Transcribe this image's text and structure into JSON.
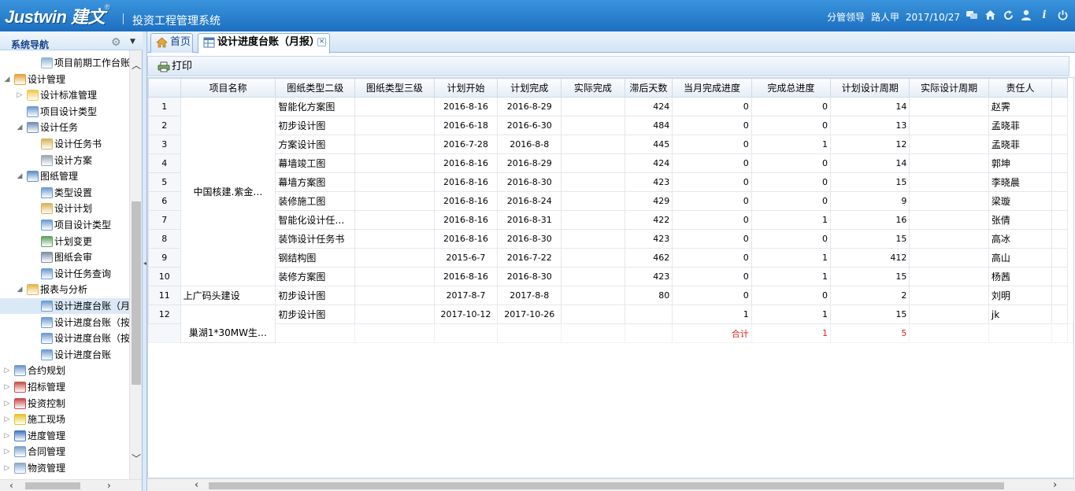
{
  "header": {
    "logo_text": "Justwin 建文",
    "logo_mark": "®",
    "system_title": "投资工程管理系统",
    "user_role": "分管领导",
    "user_name": "路人甲",
    "date": "2017/10/27"
  },
  "sidebar": {
    "title": "系统导航",
    "items": [
      {
        "label": "项目前期工作台账",
        "level": 2,
        "icon": "report-icon",
        "expand": "",
        "selected": false
      },
      {
        "label": "设计管理",
        "level": 0,
        "icon": "design-icon",
        "expand": "open",
        "selected": false
      },
      {
        "label": "设计标准管理",
        "level": 1,
        "icon": "folder-icon",
        "expand": "closed",
        "selected": false
      },
      {
        "label": "项目设计类型",
        "level": 1,
        "icon": "table-icon",
        "expand": "",
        "selected": false
      },
      {
        "label": "设计任务",
        "level": 1,
        "icon": "task-icon",
        "expand": "open",
        "selected": false
      },
      {
        "label": "设计任务书",
        "level": 2,
        "icon": "edit-icon",
        "expand": "",
        "selected": false
      },
      {
        "label": "设计方案",
        "level": 2,
        "icon": "compass-icon",
        "expand": "",
        "selected": false
      },
      {
        "label": "图纸管理",
        "level": 1,
        "icon": "drawing-icon",
        "expand": "open",
        "selected": false
      },
      {
        "label": "类型设置",
        "level": 2,
        "icon": "table-icon",
        "expand": "",
        "selected": false
      },
      {
        "label": "设计计划",
        "level": 2,
        "icon": "edit-icon",
        "expand": "",
        "selected": false
      },
      {
        "label": "项目设计类型",
        "level": 2,
        "icon": "table-icon",
        "expand": "",
        "selected": false
      },
      {
        "label": "计划变更",
        "level": 2,
        "icon": "change-icon",
        "expand": "",
        "selected": false
      },
      {
        "label": "图纸会审",
        "level": 2,
        "icon": "review-icon",
        "expand": "",
        "selected": false
      },
      {
        "label": "设计任务查询",
        "level": 2,
        "icon": "table-icon",
        "expand": "",
        "selected": false
      },
      {
        "label": "报表与分析",
        "level": 1,
        "icon": "report-folder-icon",
        "expand": "open",
        "selected": false
      },
      {
        "label": "设计进度台账（月",
        "level": 2,
        "icon": "table-icon",
        "expand": "",
        "selected": true
      },
      {
        "label": "设计进度台账（按",
        "level": 2,
        "icon": "table-icon",
        "expand": "",
        "selected": false
      },
      {
        "label": "设计进度台账（按",
        "level": 2,
        "icon": "table-icon",
        "expand": "",
        "selected": false
      },
      {
        "label": "设计进度台账",
        "level": 2,
        "icon": "table-icon",
        "expand": "",
        "selected": false
      },
      {
        "label": "合约规划",
        "level": 0,
        "icon": "contract-plan-icon",
        "expand": "closed",
        "selected": false
      },
      {
        "label": "招标管理",
        "level": 0,
        "icon": "bid-icon",
        "expand": "closed",
        "selected": false
      },
      {
        "label": "投资控制",
        "level": 0,
        "icon": "invest-icon",
        "expand": "closed",
        "selected": false
      },
      {
        "label": "施工现场",
        "level": 0,
        "icon": "site-icon",
        "expand": "closed",
        "selected": false
      },
      {
        "label": "进度管理",
        "level": 0,
        "icon": "progress-icon",
        "expand": "closed",
        "selected": false
      },
      {
        "label": "合同管理",
        "level": 0,
        "icon": "contract-icon",
        "expand": "closed",
        "selected": false
      },
      {
        "label": "物资管理",
        "level": 0,
        "icon": "material-icon",
        "expand": "closed",
        "selected": false
      }
    ]
  },
  "tabs": [
    {
      "label": "首页"
    },
    {
      "label": "设计进度台账（月报）"
    }
  ],
  "toolbar": {
    "print_label": "打印"
  },
  "table": {
    "columns": [
      "",
      "项目名称",
      "图纸类型二级",
      "图纸类型三级",
      "计划开始",
      "计划完成",
      "实际完成",
      "滞后天数",
      "当月完成进度",
      "完成总进度",
      "计划设计周期",
      "实际设计周期",
      "责任人",
      ""
    ],
    "projects": [
      "中国核建.紫金…",
      "上广码头建设",
      "巢湖1*30MW生…"
    ],
    "rows": [
      {
        "no": "1",
        "type2": "智能化方案图",
        "type3": "",
        "start": "2016-8-16",
        "end": "2016-8-29",
        "actual": "",
        "lag": "424",
        "month": "0",
        "total": "0",
        "plan_cycle": "14",
        "actual_cycle": "",
        "owner": "赵霁"
      },
      {
        "no": "2",
        "type2": "初步设计图",
        "type3": "",
        "start": "2016-6-18",
        "end": "2016-6-30",
        "actual": "",
        "lag": "484",
        "month": "0",
        "total": "0",
        "plan_cycle": "13",
        "actual_cycle": "",
        "owner": "孟晓菲"
      },
      {
        "no": "3",
        "type2": "方案设计图",
        "type3": "",
        "start": "2016-7-28",
        "end": "2016-8-8",
        "actual": "",
        "lag": "445",
        "month": "0",
        "total": "1",
        "plan_cycle": "12",
        "actual_cycle": "",
        "owner": "孟晓菲"
      },
      {
        "no": "4",
        "type2": "幕墙竣工图",
        "type3": "",
        "start": "2016-8-16",
        "end": "2016-8-29",
        "actual": "",
        "lag": "424",
        "month": "0",
        "total": "0",
        "plan_cycle": "14",
        "actual_cycle": "",
        "owner": "郭坤"
      },
      {
        "no": "5",
        "type2": "幕墙方案图",
        "type3": "",
        "start": "2016-8-16",
        "end": "2016-8-30",
        "actual": "",
        "lag": "423",
        "month": "0",
        "total": "0",
        "plan_cycle": "15",
        "actual_cycle": "",
        "owner": "李晓晨"
      },
      {
        "no": "6",
        "type2": "装修施工图",
        "type3": "",
        "start": "2016-8-16",
        "end": "2016-8-24",
        "actual": "",
        "lag": "429",
        "month": "0",
        "total": "0",
        "plan_cycle": "9",
        "actual_cycle": "",
        "owner": "梁璇"
      },
      {
        "no": "7",
        "type2": "智能化设计任…",
        "type3": "",
        "start": "2016-8-16",
        "end": "2016-8-31",
        "actual": "",
        "lag": "422",
        "month": "0",
        "total": "1",
        "plan_cycle": "16",
        "actual_cycle": "",
        "owner": "张倩"
      },
      {
        "no": "8",
        "type2": "装饰设计任务书",
        "type3": "",
        "start": "2016-8-16",
        "end": "2016-8-30",
        "actual": "",
        "lag": "423",
        "month": "0",
        "total": "0",
        "plan_cycle": "15",
        "actual_cycle": "",
        "owner": "高冰"
      },
      {
        "no": "9",
        "type2": "钢结构图",
        "type3": "",
        "start": "2015-6-7",
        "end": "2016-7-22",
        "actual": "",
        "lag": "462",
        "month": "0",
        "total": "1",
        "plan_cycle": "412",
        "actual_cycle": "",
        "owner": "高山"
      },
      {
        "no": "10",
        "type2": "装修方案图",
        "type3": "",
        "start": "2016-8-16",
        "end": "2016-8-30",
        "actual": "",
        "lag": "423",
        "month": "0",
        "total": "1",
        "plan_cycle": "15",
        "actual_cycle": "",
        "owner": "杨茜"
      },
      {
        "no": "11",
        "type2": "初步设计图",
        "type3": "",
        "start": "2017-8-7",
        "end": "2017-8-8",
        "actual": "",
        "lag": "80",
        "month": "0",
        "total": "0",
        "plan_cycle": "2",
        "actual_cycle": "",
        "owner": "刘明"
      },
      {
        "no": "12",
        "type2": "初步设计图",
        "type3": "",
        "start": "2017-10-12",
        "end": "2017-10-26",
        "actual": "",
        "lag": "",
        "month": "1",
        "total": "1",
        "plan_cycle": "15",
        "actual_cycle": "",
        "owner": "jk"
      }
    ],
    "total_label": "合计",
    "total_month": "1",
    "total_overall": "5"
  },
  "colors": {
    "header": "#2a84d2",
    "accent_text": "#15428b",
    "total_red": "#e0201c",
    "selected_row": "#dbe9f7"
  }
}
